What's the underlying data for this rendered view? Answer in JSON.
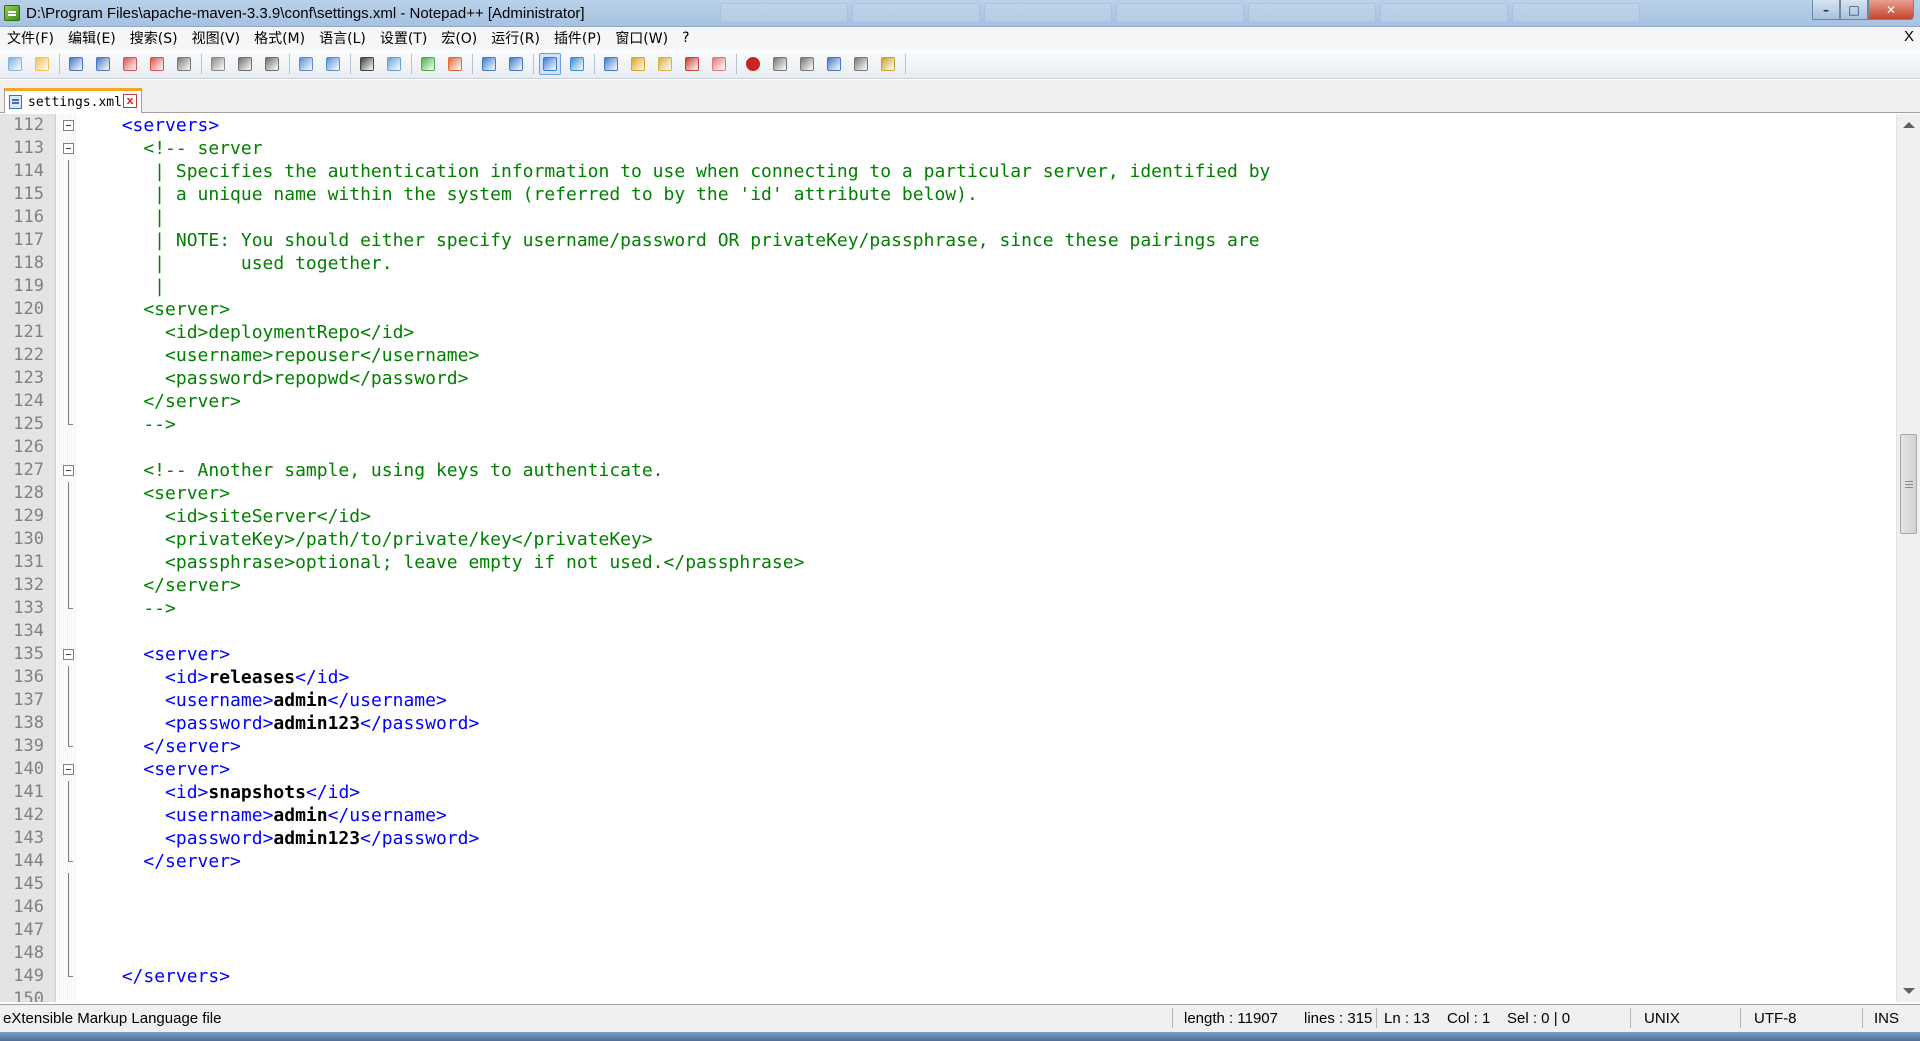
{
  "window": {
    "title": "D:\\Program Files\\apache-maven-3.3.9\\conf\\settings.xml - Notepad++ [Administrator]",
    "controls": {
      "minimize": "–",
      "maximize": "□",
      "close": "✕"
    }
  },
  "menu": {
    "items": [
      "文件(F)",
      "编辑(E)",
      "搜索(S)",
      "视图(V)",
      "格式(M)",
      "语言(L)",
      "设置(T)",
      "宏(O)",
      "运行(R)",
      "插件(P)",
      "窗口(W)",
      "?"
    ],
    "close_doc": "X"
  },
  "tab": {
    "label": "settings.xml",
    "close": "x"
  },
  "editor": {
    "lines": [
      {
        "n": "112",
        "fold": "open",
        "seg": [
          [
            "  ",
            "t"
          ],
          [
            "<servers>",
            "tag"
          ]
        ]
      },
      {
        "n": "113",
        "fold": "open",
        "seg": [
          [
            "    ",
            "t"
          ],
          [
            "<!-- server",
            "cmt"
          ]
        ]
      },
      {
        "n": "114",
        "fold": "mid",
        "seg": [
          [
            "     | Specifies the authentication information to use when connecting to a particular server, identified by",
            "cmt"
          ]
        ]
      },
      {
        "n": "115",
        "fold": "mid",
        "seg": [
          [
            "     | a unique name within the system (referred to by the 'id' attribute below).",
            "cmt"
          ]
        ]
      },
      {
        "n": "116",
        "fold": "mid",
        "seg": [
          [
            "     |",
            "cmt"
          ]
        ]
      },
      {
        "n": "117",
        "fold": "mid",
        "seg": [
          [
            "     | NOTE: You should either specify username/password OR privateKey/passphrase, since these pairings are",
            "cmt"
          ]
        ]
      },
      {
        "n": "118",
        "fold": "mid",
        "seg": [
          [
            "     |       used together.",
            "cmt"
          ]
        ]
      },
      {
        "n": "119",
        "fold": "mid",
        "seg": [
          [
            "     |",
            "cmt"
          ]
        ]
      },
      {
        "n": "120",
        "fold": "mid",
        "seg": [
          [
            "    <server>",
            "cmt"
          ]
        ]
      },
      {
        "n": "121",
        "fold": "mid",
        "seg": [
          [
            "      <id>deploymentRepo</id>",
            "cmt"
          ]
        ]
      },
      {
        "n": "122",
        "fold": "mid",
        "seg": [
          [
            "      <username>repouser</username>",
            "cmt"
          ]
        ]
      },
      {
        "n": "123",
        "fold": "mid",
        "seg": [
          [
            "      <password>repopwd</password>",
            "cmt"
          ]
        ]
      },
      {
        "n": "124",
        "fold": "mid",
        "seg": [
          [
            "    </server>",
            "cmt"
          ]
        ]
      },
      {
        "n": "125",
        "fold": "end",
        "seg": [
          [
            "    -->",
            "cmt"
          ]
        ]
      },
      {
        "n": "126",
        "fold": "none",
        "seg": []
      },
      {
        "n": "127",
        "fold": "open",
        "seg": [
          [
            "    <!-- Another sample, using keys to authenticate.",
            "cmt"
          ]
        ]
      },
      {
        "n": "128",
        "fold": "mid",
        "seg": [
          [
            "    <server>",
            "cmt"
          ]
        ]
      },
      {
        "n": "129",
        "fold": "mid",
        "seg": [
          [
            "      <id>siteServer</id>",
            "cmt"
          ]
        ]
      },
      {
        "n": "130",
        "fold": "mid",
        "seg": [
          [
            "      <privateKey>/path/to/private/key</privateKey>",
            "cmt"
          ]
        ]
      },
      {
        "n": "131",
        "fold": "mid",
        "seg": [
          [
            "      <passphrase>optional; leave empty if not used.</passphrase>",
            "cmt"
          ]
        ]
      },
      {
        "n": "132",
        "fold": "mid",
        "seg": [
          [
            "    </server>",
            "cmt"
          ]
        ]
      },
      {
        "n": "133",
        "fold": "end",
        "seg": [
          [
            "    -->",
            "cmt"
          ]
        ]
      },
      {
        "n": "134",
        "fold": "none",
        "seg": []
      },
      {
        "n": "135",
        "fold": "open",
        "seg": [
          [
            "    ",
            "t"
          ],
          [
            "<server>",
            "tag"
          ]
        ]
      },
      {
        "n": "136",
        "fold": "mid",
        "seg": [
          [
            "      ",
            "t"
          ],
          [
            "<id>",
            "tag"
          ],
          [
            "releases",
            "bold"
          ],
          [
            "</id>",
            "tag"
          ]
        ]
      },
      {
        "n": "137",
        "fold": "mid",
        "seg": [
          [
            "      ",
            "t"
          ],
          [
            "<username>",
            "tag"
          ],
          [
            "admin",
            "bold"
          ],
          [
            "</username>",
            "tag"
          ]
        ]
      },
      {
        "n": "138",
        "fold": "mid",
        "seg": [
          [
            "      ",
            "t"
          ],
          [
            "<password>",
            "tag"
          ],
          [
            "admin123",
            "bold"
          ],
          [
            "</password>",
            "tag"
          ]
        ]
      },
      {
        "n": "139",
        "fold": "end",
        "seg": [
          [
            "    ",
            "t"
          ],
          [
            "</server>",
            "tag"
          ]
        ]
      },
      {
        "n": "140",
        "fold": "open",
        "seg": [
          [
            "    ",
            "t"
          ],
          [
            "<server>",
            "tag"
          ]
        ]
      },
      {
        "n": "141",
        "fold": "mid",
        "seg": [
          [
            "      ",
            "t"
          ],
          [
            "<id>",
            "tag"
          ],
          [
            "snapshots",
            "bold"
          ],
          [
            "</id>",
            "tag"
          ]
        ]
      },
      {
        "n": "142",
        "fold": "mid",
        "seg": [
          [
            "      ",
            "t"
          ],
          [
            "<username>",
            "tag"
          ],
          [
            "admin",
            "bold"
          ],
          [
            "</username>",
            "tag"
          ]
        ]
      },
      {
        "n": "143",
        "fold": "mid",
        "seg": [
          [
            "      ",
            "t"
          ],
          [
            "<password>",
            "tag"
          ],
          [
            "admin123",
            "bold"
          ],
          [
            "</password>",
            "tag"
          ]
        ]
      },
      {
        "n": "144",
        "fold": "end",
        "seg": [
          [
            "    ",
            "t"
          ],
          [
            "</server>",
            "tag"
          ]
        ]
      },
      {
        "n": "145",
        "fold": "mid",
        "seg": []
      },
      {
        "n": "146",
        "fold": "mid",
        "seg": []
      },
      {
        "n": "147",
        "fold": "mid",
        "seg": []
      },
      {
        "n": "148",
        "fold": "mid",
        "seg": []
      },
      {
        "n": "149",
        "fold": "end",
        "seg": [
          [
            "  ",
            "t"
          ],
          [
            "</servers>",
            "tag"
          ]
        ]
      },
      {
        "n": "150",
        "fold": "none",
        "seg": []
      }
    ]
  },
  "status": {
    "filetype": "eXtensible Markup Language file",
    "length": "length : 11907",
    "lines": "lines : 315",
    "ln": "Ln : 13",
    "col": "Col : 1",
    "sel": "Sel : 0 | 0",
    "eol": "UNIX",
    "encoding": "UTF-8",
    "mode": "INS"
  },
  "colors": {
    "tag": "#0000ff",
    "comment": "#008000",
    "text": "#000000",
    "tab_accent": "#f5a623"
  },
  "toolbar": {
    "icons": [
      "new-file-icon",
      "open-file-icon",
      "save-icon",
      "save-all-icon",
      "close-icon",
      "close-all-icon",
      "print-icon",
      "cut-icon",
      "copy-icon",
      "paste-icon",
      "undo-icon",
      "redo-icon",
      "find-icon",
      "replace-icon",
      "zoom-in-icon",
      "zoom-out-icon",
      "sync-vertical-icon",
      "sync-horizontal-icon",
      "word-wrap-icon",
      "show-all-chars-icon",
      "indent-guide-icon",
      "user-lang-icon",
      "doc-map-icon",
      "function-list-icon",
      "folder-workspace-icon",
      "record-macro-icon",
      "stop-macro-icon",
      "play-macro-icon",
      "run-macro-multiple-icon",
      "save-macro-icon",
      "spell-check-icon"
    ]
  }
}
